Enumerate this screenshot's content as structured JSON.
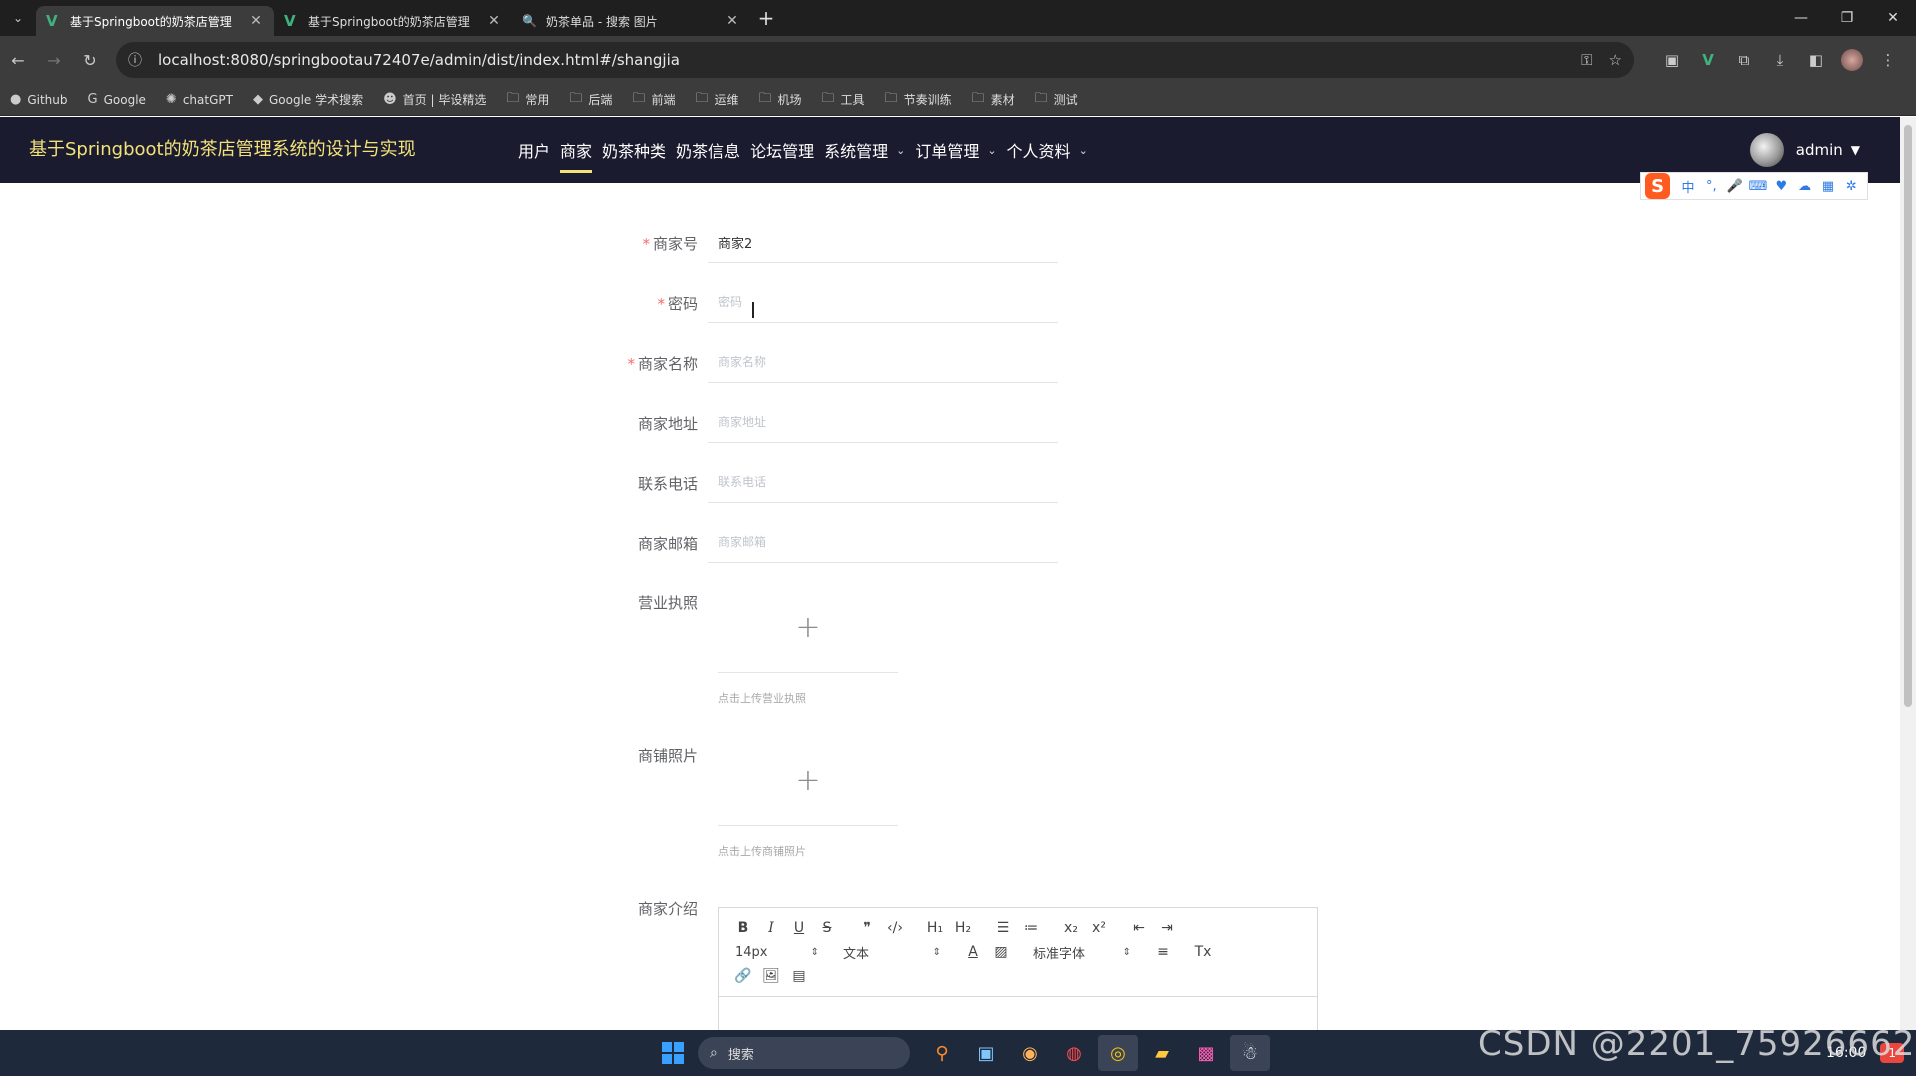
{
  "browser": {
    "tabs": [
      {
        "title": "基于Springboot的奶茶店管理",
        "active": true,
        "icon": "vue-icon"
      },
      {
        "title": "基于Springboot的奶茶店管理",
        "active": false,
        "icon": "vue-icon"
      },
      {
        "title": "奶茶单品 - 搜索 图片",
        "active": false,
        "icon": "search-icon"
      }
    ],
    "url": "localhost:8080/springbootau72407e/admin/dist/index.html#/shangjia",
    "bookmarks": [
      {
        "label": "Github",
        "icon": "github-icon"
      },
      {
        "label": "Google",
        "icon": "google-icon"
      },
      {
        "label": "chatGPT",
        "icon": "chatgpt-icon"
      },
      {
        "label": "Google 学术搜索",
        "icon": "scholar-icon"
      },
      {
        "label": "首页 | 毕设精选",
        "icon": "site-icon"
      },
      {
        "label": "常用",
        "icon": "folder-icon"
      },
      {
        "label": "后端",
        "icon": "folder-icon"
      },
      {
        "label": "前端",
        "icon": "folder-icon"
      },
      {
        "label": "运维",
        "icon": "folder-icon"
      },
      {
        "label": "机场",
        "icon": "folder-icon"
      },
      {
        "label": "工具",
        "icon": "folder-icon"
      },
      {
        "label": "节奏训练",
        "icon": "folder-icon"
      },
      {
        "label": "素材",
        "icon": "folder-icon"
      },
      {
        "label": "测试",
        "icon": "folder-icon"
      }
    ]
  },
  "app": {
    "title": "基于Springboot的奶茶店管理系统的设计与实现",
    "nav": [
      {
        "label": "用户",
        "active": false,
        "dropdown": false
      },
      {
        "label": "商家",
        "active": true,
        "dropdown": false
      },
      {
        "label": "奶茶种类",
        "active": false,
        "dropdown": false
      },
      {
        "label": "奶茶信息",
        "active": false,
        "dropdown": false
      },
      {
        "label": "论坛管理",
        "active": false,
        "dropdown": false
      },
      {
        "label": "系统管理",
        "active": false,
        "dropdown": true
      },
      {
        "label": "订单管理",
        "active": false,
        "dropdown": true
      },
      {
        "label": "个人资料",
        "active": false,
        "dropdown": true
      }
    ],
    "user": "admin",
    "accent": "#f3e27a",
    "header_bg": "#1a1b2e"
  },
  "form": {
    "shangjiahao": {
      "label": "商家号",
      "value": "商家2",
      "placeholder": "商家号",
      "required": true
    },
    "mima": {
      "label": "密码",
      "value": "",
      "placeholder": "密码",
      "required": true
    },
    "shangjiamingcheng": {
      "label": "商家名称",
      "value": "",
      "placeholder": "商家名称",
      "required": true
    },
    "shangjiadizhi": {
      "label": "商家地址",
      "value": "",
      "placeholder": "商家地址",
      "required": false
    },
    "lianxidianhua": {
      "label": "联系电话",
      "value": "",
      "placeholder": "联系电话",
      "required": false
    },
    "shangjiayouxiang": {
      "label": "商家邮箱",
      "value": "",
      "placeholder": "商家邮箱",
      "required": false
    },
    "license": {
      "label": "营业执照",
      "tip": "点击上传营业执照"
    },
    "shop_photo": {
      "label": "商铺照片",
      "tip": "点击上传商铺照片"
    },
    "intro": {
      "label": "商家介绍"
    }
  },
  "editor": {
    "font_size": "14px",
    "header_select": "文本",
    "font_family": "标准字体"
  },
  "taskbar": {
    "search_placeholder": "搜索",
    "time": "16:00",
    "badge": "1"
  },
  "watermark": "CSDN @2201_75926662"
}
